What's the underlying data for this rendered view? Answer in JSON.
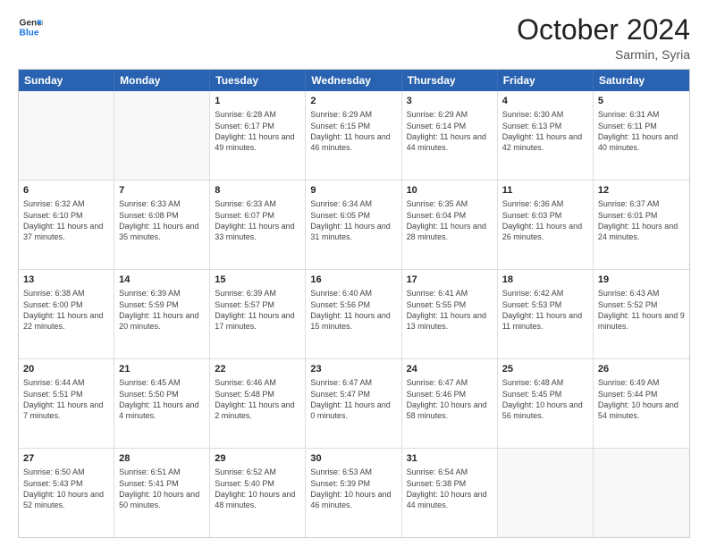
{
  "header": {
    "logo_line1": "General",
    "logo_line2": "Blue",
    "month": "October 2024",
    "location": "Sarmin, Syria"
  },
  "weekdays": [
    "Sunday",
    "Monday",
    "Tuesday",
    "Wednesday",
    "Thursday",
    "Friday",
    "Saturday"
  ],
  "weeks": [
    [
      {
        "day": "",
        "sunrise": "",
        "sunset": "",
        "daylight": "",
        "empty": true
      },
      {
        "day": "",
        "sunrise": "",
        "sunset": "",
        "daylight": "",
        "empty": true
      },
      {
        "day": "1",
        "sunrise": "Sunrise: 6:28 AM",
        "sunset": "Sunset: 6:17 PM",
        "daylight": "Daylight: 11 hours and 49 minutes."
      },
      {
        "day": "2",
        "sunrise": "Sunrise: 6:29 AM",
        "sunset": "Sunset: 6:15 PM",
        "daylight": "Daylight: 11 hours and 46 minutes."
      },
      {
        "day": "3",
        "sunrise": "Sunrise: 6:29 AM",
        "sunset": "Sunset: 6:14 PM",
        "daylight": "Daylight: 11 hours and 44 minutes."
      },
      {
        "day": "4",
        "sunrise": "Sunrise: 6:30 AM",
        "sunset": "Sunset: 6:13 PM",
        "daylight": "Daylight: 11 hours and 42 minutes."
      },
      {
        "day": "5",
        "sunrise": "Sunrise: 6:31 AM",
        "sunset": "Sunset: 6:11 PM",
        "daylight": "Daylight: 11 hours and 40 minutes."
      }
    ],
    [
      {
        "day": "6",
        "sunrise": "Sunrise: 6:32 AM",
        "sunset": "Sunset: 6:10 PM",
        "daylight": "Daylight: 11 hours and 37 minutes."
      },
      {
        "day": "7",
        "sunrise": "Sunrise: 6:33 AM",
        "sunset": "Sunset: 6:08 PM",
        "daylight": "Daylight: 11 hours and 35 minutes."
      },
      {
        "day": "8",
        "sunrise": "Sunrise: 6:33 AM",
        "sunset": "Sunset: 6:07 PM",
        "daylight": "Daylight: 11 hours and 33 minutes."
      },
      {
        "day": "9",
        "sunrise": "Sunrise: 6:34 AM",
        "sunset": "Sunset: 6:05 PM",
        "daylight": "Daylight: 11 hours and 31 minutes."
      },
      {
        "day": "10",
        "sunrise": "Sunrise: 6:35 AM",
        "sunset": "Sunset: 6:04 PM",
        "daylight": "Daylight: 11 hours and 28 minutes."
      },
      {
        "day": "11",
        "sunrise": "Sunrise: 6:36 AM",
        "sunset": "Sunset: 6:03 PM",
        "daylight": "Daylight: 11 hours and 26 minutes."
      },
      {
        "day": "12",
        "sunrise": "Sunrise: 6:37 AM",
        "sunset": "Sunset: 6:01 PM",
        "daylight": "Daylight: 11 hours and 24 minutes."
      }
    ],
    [
      {
        "day": "13",
        "sunrise": "Sunrise: 6:38 AM",
        "sunset": "Sunset: 6:00 PM",
        "daylight": "Daylight: 11 hours and 22 minutes."
      },
      {
        "day": "14",
        "sunrise": "Sunrise: 6:39 AM",
        "sunset": "Sunset: 5:59 PM",
        "daylight": "Daylight: 11 hours and 20 minutes."
      },
      {
        "day": "15",
        "sunrise": "Sunrise: 6:39 AM",
        "sunset": "Sunset: 5:57 PM",
        "daylight": "Daylight: 11 hours and 17 minutes."
      },
      {
        "day": "16",
        "sunrise": "Sunrise: 6:40 AM",
        "sunset": "Sunset: 5:56 PM",
        "daylight": "Daylight: 11 hours and 15 minutes."
      },
      {
        "day": "17",
        "sunrise": "Sunrise: 6:41 AM",
        "sunset": "Sunset: 5:55 PM",
        "daylight": "Daylight: 11 hours and 13 minutes."
      },
      {
        "day": "18",
        "sunrise": "Sunrise: 6:42 AM",
        "sunset": "Sunset: 5:53 PM",
        "daylight": "Daylight: 11 hours and 11 minutes."
      },
      {
        "day": "19",
        "sunrise": "Sunrise: 6:43 AM",
        "sunset": "Sunset: 5:52 PM",
        "daylight": "Daylight: 11 hours and 9 minutes."
      }
    ],
    [
      {
        "day": "20",
        "sunrise": "Sunrise: 6:44 AM",
        "sunset": "Sunset: 5:51 PM",
        "daylight": "Daylight: 11 hours and 7 minutes."
      },
      {
        "day": "21",
        "sunrise": "Sunrise: 6:45 AM",
        "sunset": "Sunset: 5:50 PM",
        "daylight": "Daylight: 11 hours and 4 minutes."
      },
      {
        "day": "22",
        "sunrise": "Sunrise: 6:46 AM",
        "sunset": "Sunset: 5:48 PM",
        "daylight": "Daylight: 11 hours and 2 minutes."
      },
      {
        "day": "23",
        "sunrise": "Sunrise: 6:47 AM",
        "sunset": "Sunset: 5:47 PM",
        "daylight": "Daylight: 11 hours and 0 minutes."
      },
      {
        "day": "24",
        "sunrise": "Sunrise: 6:47 AM",
        "sunset": "Sunset: 5:46 PM",
        "daylight": "Daylight: 10 hours and 58 minutes."
      },
      {
        "day": "25",
        "sunrise": "Sunrise: 6:48 AM",
        "sunset": "Sunset: 5:45 PM",
        "daylight": "Daylight: 10 hours and 56 minutes."
      },
      {
        "day": "26",
        "sunrise": "Sunrise: 6:49 AM",
        "sunset": "Sunset: 5:44 PM",
        "daylight": "Daylight: 10 hours and 54 minutes."
      }
    ],
    [
      {
        "day": "27",
        "sunrise": "Sunrise: 6:50 AM",
        "sunset": "Sunset: 5:43 PM",
        "daylight": "Daylight: 10 hours and 52 minutes."
      },
      {
        "day": "28",
        "sunrise": "Sunrise: 6:51 AM",
        "sunset": "Sunset: 5:41 PM",
        "daylight": "Daylight: 10 hours and 50 minutes."
      },
      {
        "day": "29",
        "sunrise": "Sunrise: 6:52 AM",
        "sunset": "Sunset: 5:40 PM",
        "daylight": "Daylight: 10 hours and 48 minutes."
      },
      {
        "day": "30",
        "sunrise": "Sunrise: 6:53 AM",
        "sunset": "Sunset: 5:39 PM",
        "daylight": "Daylight: 10 hours and 46 minutes."
      },
      {
        "day": "31",
        "sunrise": "Sunrise: 6:54 AM",
        "sunset": "Sunset: 5:38 PM",
        "daylight": "Daylight: 10 hours and 44 minutes."
      },
      {
        "day": "",
        "sunrise": "",
        "sunset": "",
        "daylight": "",
        "empty": true
      },
      {
        "day": "",
        "sunrise": "",
        "sunset": "",
        "daylight": "",
        "empty": true
      }
    ]
  ]
}
